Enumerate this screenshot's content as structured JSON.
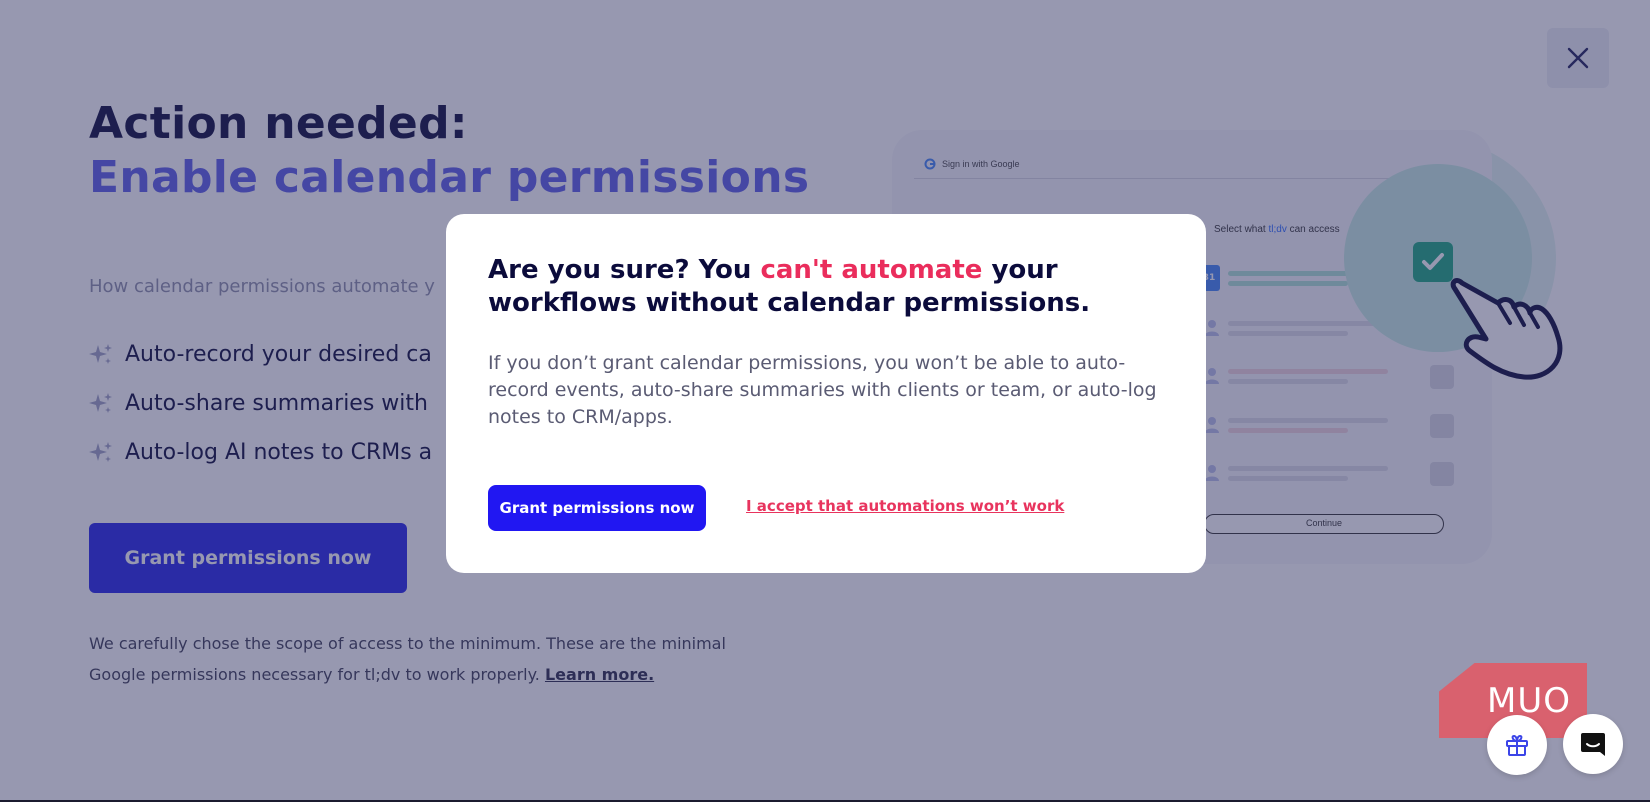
{
  "page": {
    "title_line1": "Action needed:",
    "title_line2": "Enable calendar permissions",
    "subtitle": "How calendar permissions automate y",
    "benefits": [
      {
        "icon": "sparkle-icon",
        "text": "Auto-record your desired ca"
      },
      {
        "icon": "sparkle-icon",
        "text": "Auto-share summaries with"
      },
      {
        "icon": "sparkle-icon",
        "text": "Auto-log AI notes to CRMs a"
      }
    ],
    "cta_label": "Grant permissions now",
    "scope_note": "We carefully chose the scope of access to the minimum. These are the minimal Google permissions necessary for tl;dv to work properly.",
    "learn_more": "Learn more."
  },
  "illustration": {
    "signin_label": "Sign in with Google",
    "select_prefix": "Select what ",
    "select_brand": "tl;dv",
    "select_suffix": " can access",
    "continue_label": "Continue",
    "calendar_icon_text": "31"
  },
  "modal": {
    "heading_pre": "Are you sure? You ",
    "heading_warn": "can't automate",
    "heading_post": " your workflows without calendar permissions.",
    "body": "If you don’t grant calendar permissions, you won’t be able to auto-record events, auto-share summaries with clients or team, or auto-log notes to CRM/apps.",
    "grant_label": "Grant permissions now",
    "accept_label": "I accept that automations won’t work"
  },
  "watermark": "MUO",
  "colors": {
    "navy": "#0b0b3b",
    "accent_purple": "#5b5ce6",
    "primary_blue": "#2117f2",
    "warning_red": "#ea2d5c",
    "check_green": "#1aa77f"
  }
}
